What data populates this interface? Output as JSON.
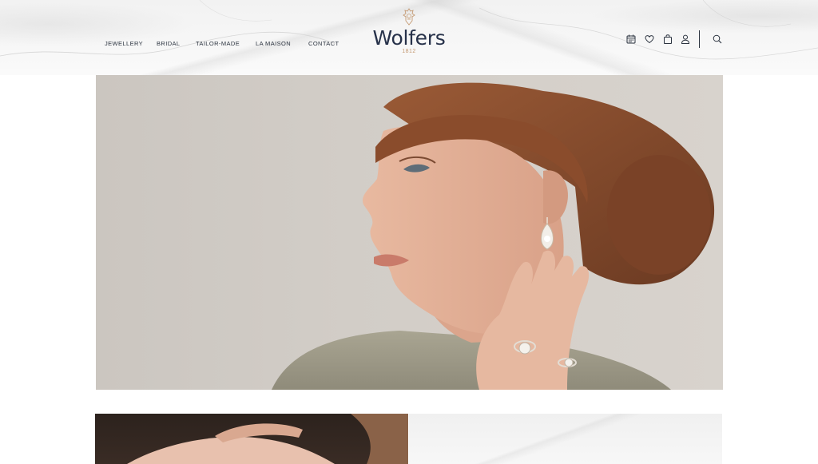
{
  "nav": {
    "items": [
      {
        "label": "JEWELLERY",
        "name": "nav-jewellery"
      },
      {
        "label": "BRIDAL",
        "name": "nav-bridal"
      },
      {
        "label": "TAILOR-MADE",
        "name": "nav-tailor-made"
      },
      {
        "label": "LA MAISON",
        "name": "nav-la-maison"
      },
      {
        "label": "CONTACT",
        "name": "nav-contact"
      }
    ]
  },
  "brand": {
    "title": "Wolfers",
    "year": "1812",
    "accent_color": "#c49a73",
    "text_color": "#27324a"
  },
  "header_icons": [
    "calendar-icon",
    "heart-icon",
    "shopping-bag-icon",
    "user-icon",
    "search-icon"
  ],
  "hero": {
    "image": "woman-profile-with-diamond-earring-and-rings-photo"
  },
  "promos": [
    {
      "image": "hand-with-ring-photo"
    },
    {
      "image": "marble-texture-background"
    }
  ]
}
